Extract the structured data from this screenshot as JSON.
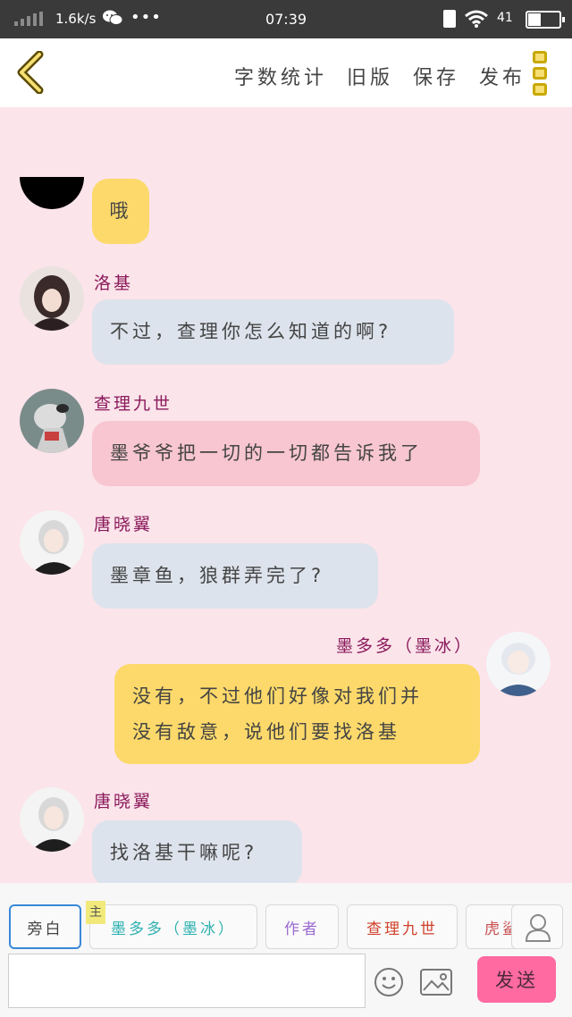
{
  "status_bar": {
    "speed": "1.6k/s",
    "dots": "•••",
    "time": "07:39",
    "battery_pct": "41",
    "battery_level": 0.41
  },
  "header": {
    "actions": [
      "字数统计",
      "旧版",
      "保存",
      "发布"
    ]
  },
  "chat": {
    "top_mark": "ʒ",
    "messages": [
      {
        "sender": "",
        "text": "哦",
        "side": "left",
        "color": "#fcd96a"
      },
      {
        "sender": "洛基",
        "text": "不过，查理你怎么知道的啊?",
        "side": "left",
        "color": "#dde3ec"
      },
      {
        "sender": "查理九世",
        "text": "墨爷爷把一切的一切都告诉我了",
        "side": "left",
        "color": "#f8c6d0"
      },
      {
        "sender": "唐晓翼",
        "text": "墨章鱼，狼群弄完了?",
        "side": "left",
        "color": "#dde3ec"
      },
      {
        "sender": "墨多多（墨冰）",
        "text_lines": [
          "没有，不过他们好像对我们并",
          "没有敌意，说他们要找洛基"
        ],
        "side": "right",
        "color": "#fcd96a"
      },
      {
        "sender": "唐晓翼",
        "text": "找洛基干嘛呢?",
        "side": "left",
        "color": "#dde3ec"
      }
    ]
  },
  "roles": {
    "host_tag": "主",
    "items": [
      {
        "label": "旁白",
        "color": "#444444"
      },
      {
        "label": "墨多多（墨冰）",
        "color": "#2fb0b0"
      },
      {
        "label": "作者",
        "color": "#9b6bd1"
      },
      {
        "label": "查理九世",
        "color": "#d0402a"
      },
      {
        "label": "虎鲨",
        "color": "#c85050"
      }
    ]
  },
  "composer": {
    "input_value": "",
    "send_label": "发送"
  }
}
